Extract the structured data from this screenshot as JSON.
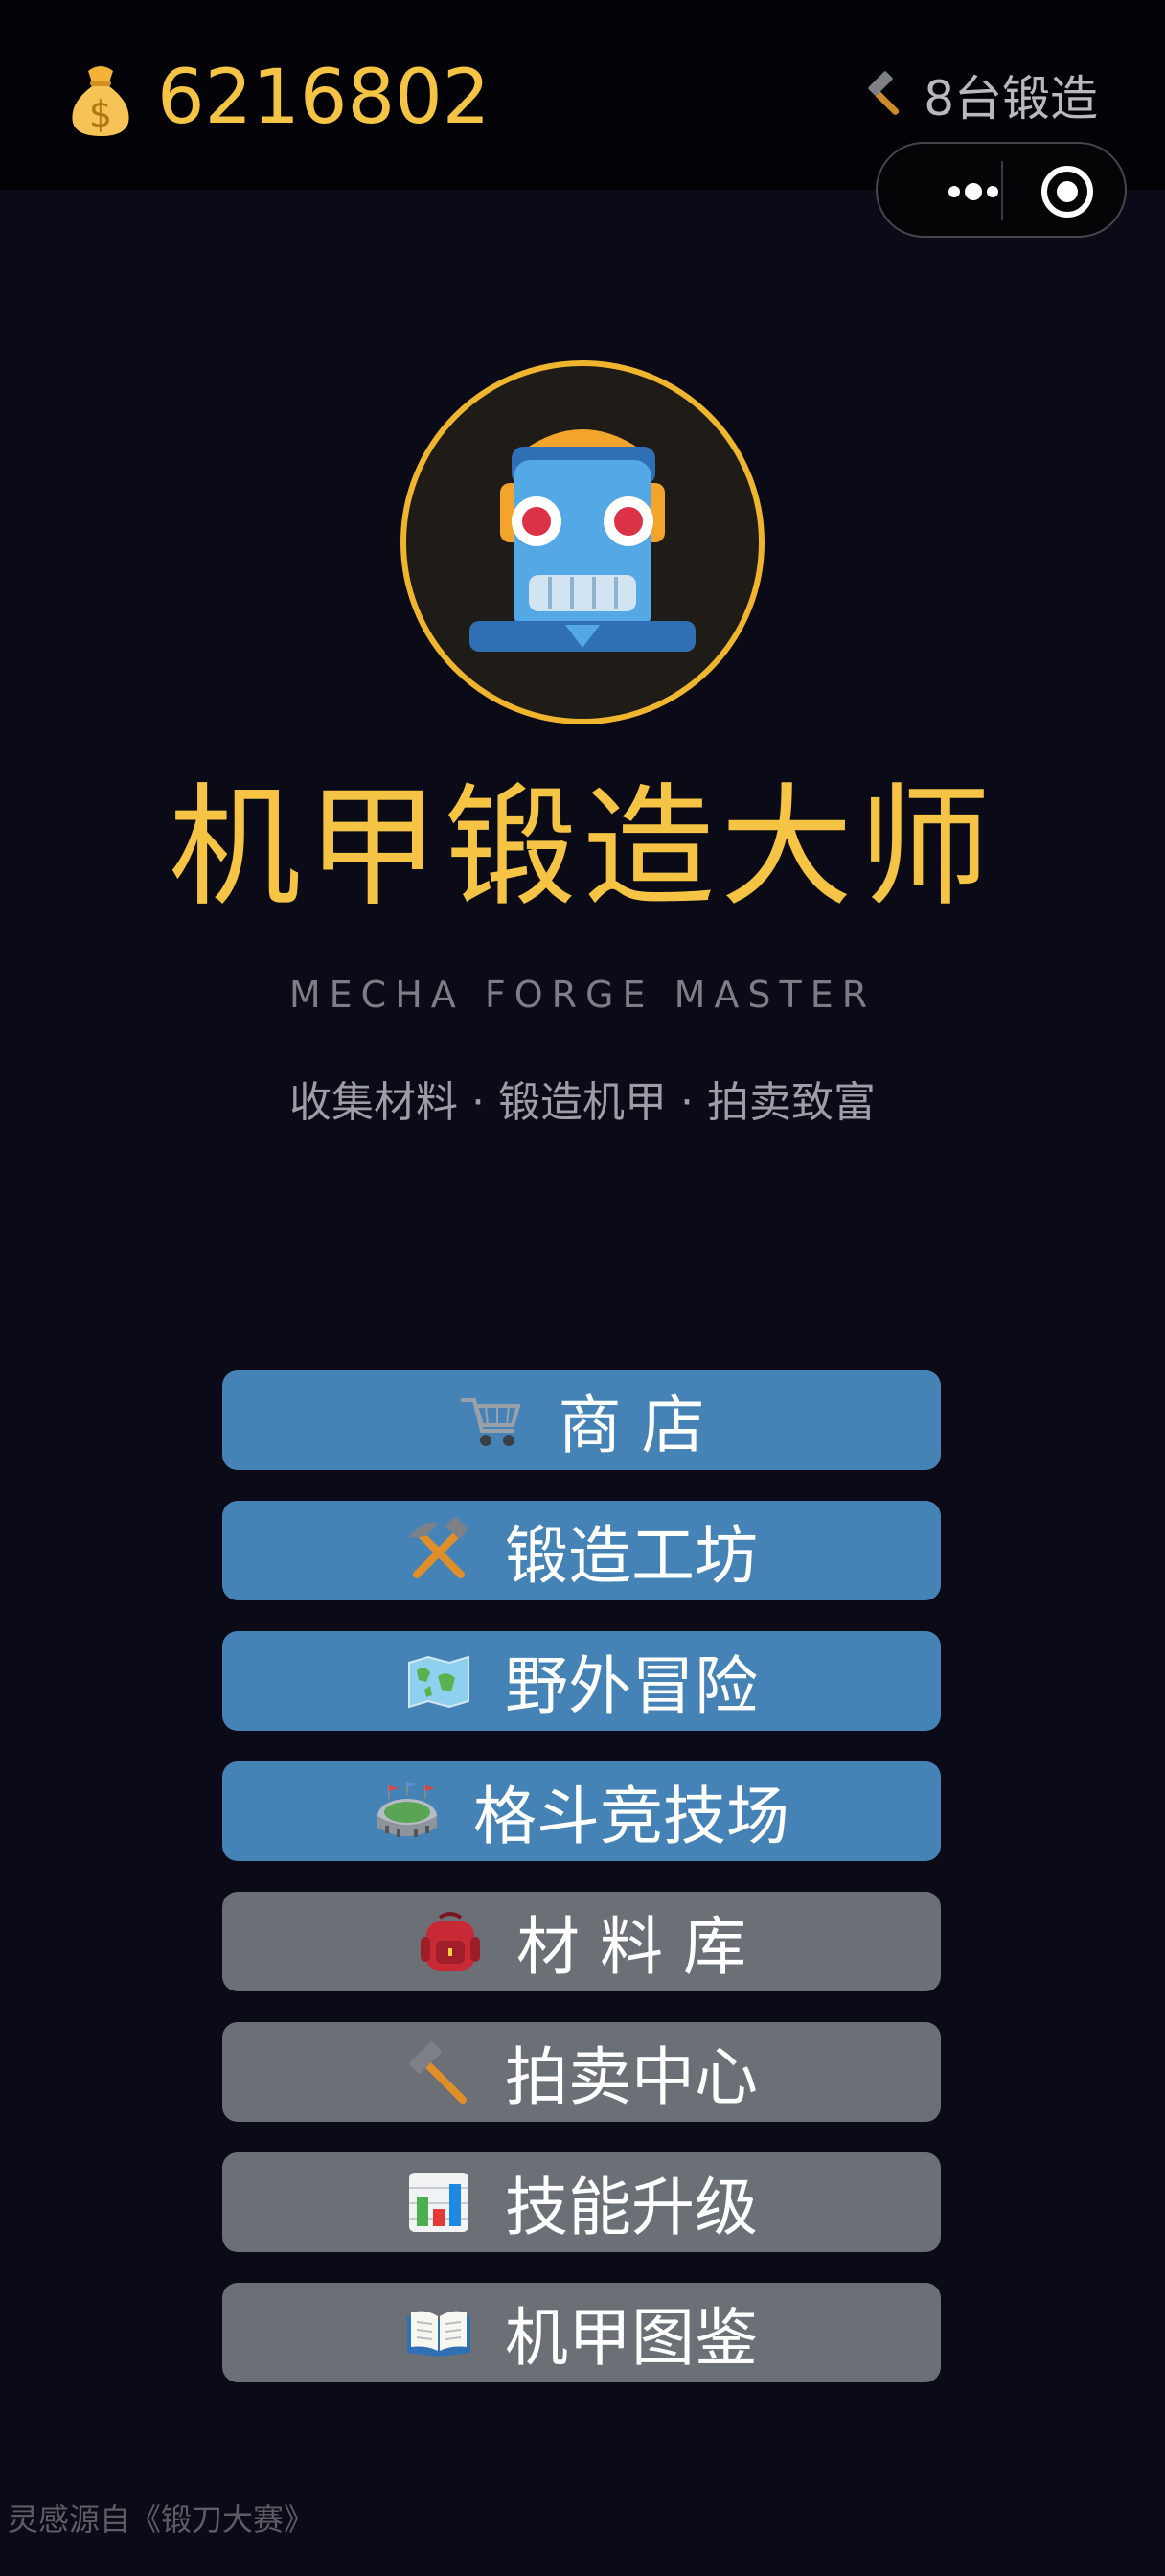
{
  "header": {
    "coin_icon": "money-bag-icon",
    "coins": "6216802",
    "forge_icon": "hammer-icon",
    "forge_count": "8台锻造"
  },
  "capsule": {
    "more_icon": "more-dots-icon",
    "close_icon": "target-close-icon"
  },
  "hero": {
    "logo_icon": "robot-face-icon",
    "title": "机甲锻造大师",
    "subtitle": "MECHA FORGE MASTER",
    "tagline": "收集材料 · 锻造机甲 · 拍卖致富"
  },
  "menu": [
    {
      "label": "商 店",
      "icon": "shopping-cart-icon",
      "color": "#4583b7"
    },
    {
      "label": "锻造工坊",
      "icon": "hammer-and-pick-icon",
      "color": "#4583b7"
    },
    {
      "label": "野外冒险",
      "icon": "world-map-icon",
      "color": "#4583b7"
    },
    {
      "label": "格斗竞技场",
      "icon": "stadium-icon",
      "color": "#4583b7"
    },
    {
      "label": "材 料 库",
      "icon": "backpack-icon",
      "color": "#6b7077"
    },
    {
      "label": "拍卖中心",
      "icon": "hammer-icon",
      "color": "#6b7077"
    },
    {
      "label": "技能升级",
      "icon": "bar-chart-icon",
      "color": "#6b7077"
    },
    {
      "label": "机甲图鉴",
      "icon": "open-book-icon",
      "color": "#6b7077"
    }
  ],
  "footer": {
    "credit": "灵感源自《锻刀大赛》"
  },
  "colors": {
    "accent": "#f6c445",
    "background": "#0a0b16",
    "primary_button": "#4583b7",
    "secondary_button": "#6b7077"
  }
}
